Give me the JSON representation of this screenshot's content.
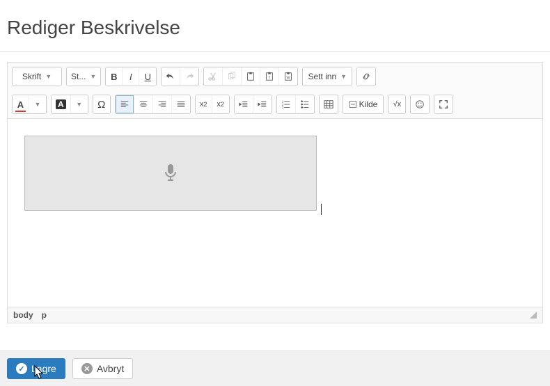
{
  "header": {
    "title": "Rediger Beskrivelse"
  },
  "toolbar": {
    "font_label": "Skrift",
    "size_label": "St...",
    "insert_label": "Sett inn",
    "source_label": "Kilde",
    "math_label": "√x"
  },
  "status": {
    "path1": "body",
    "path2": "p"
  },
  "footer": {
    "save": "Lagre",
    "cancel": "Avbryt"
  }
}
